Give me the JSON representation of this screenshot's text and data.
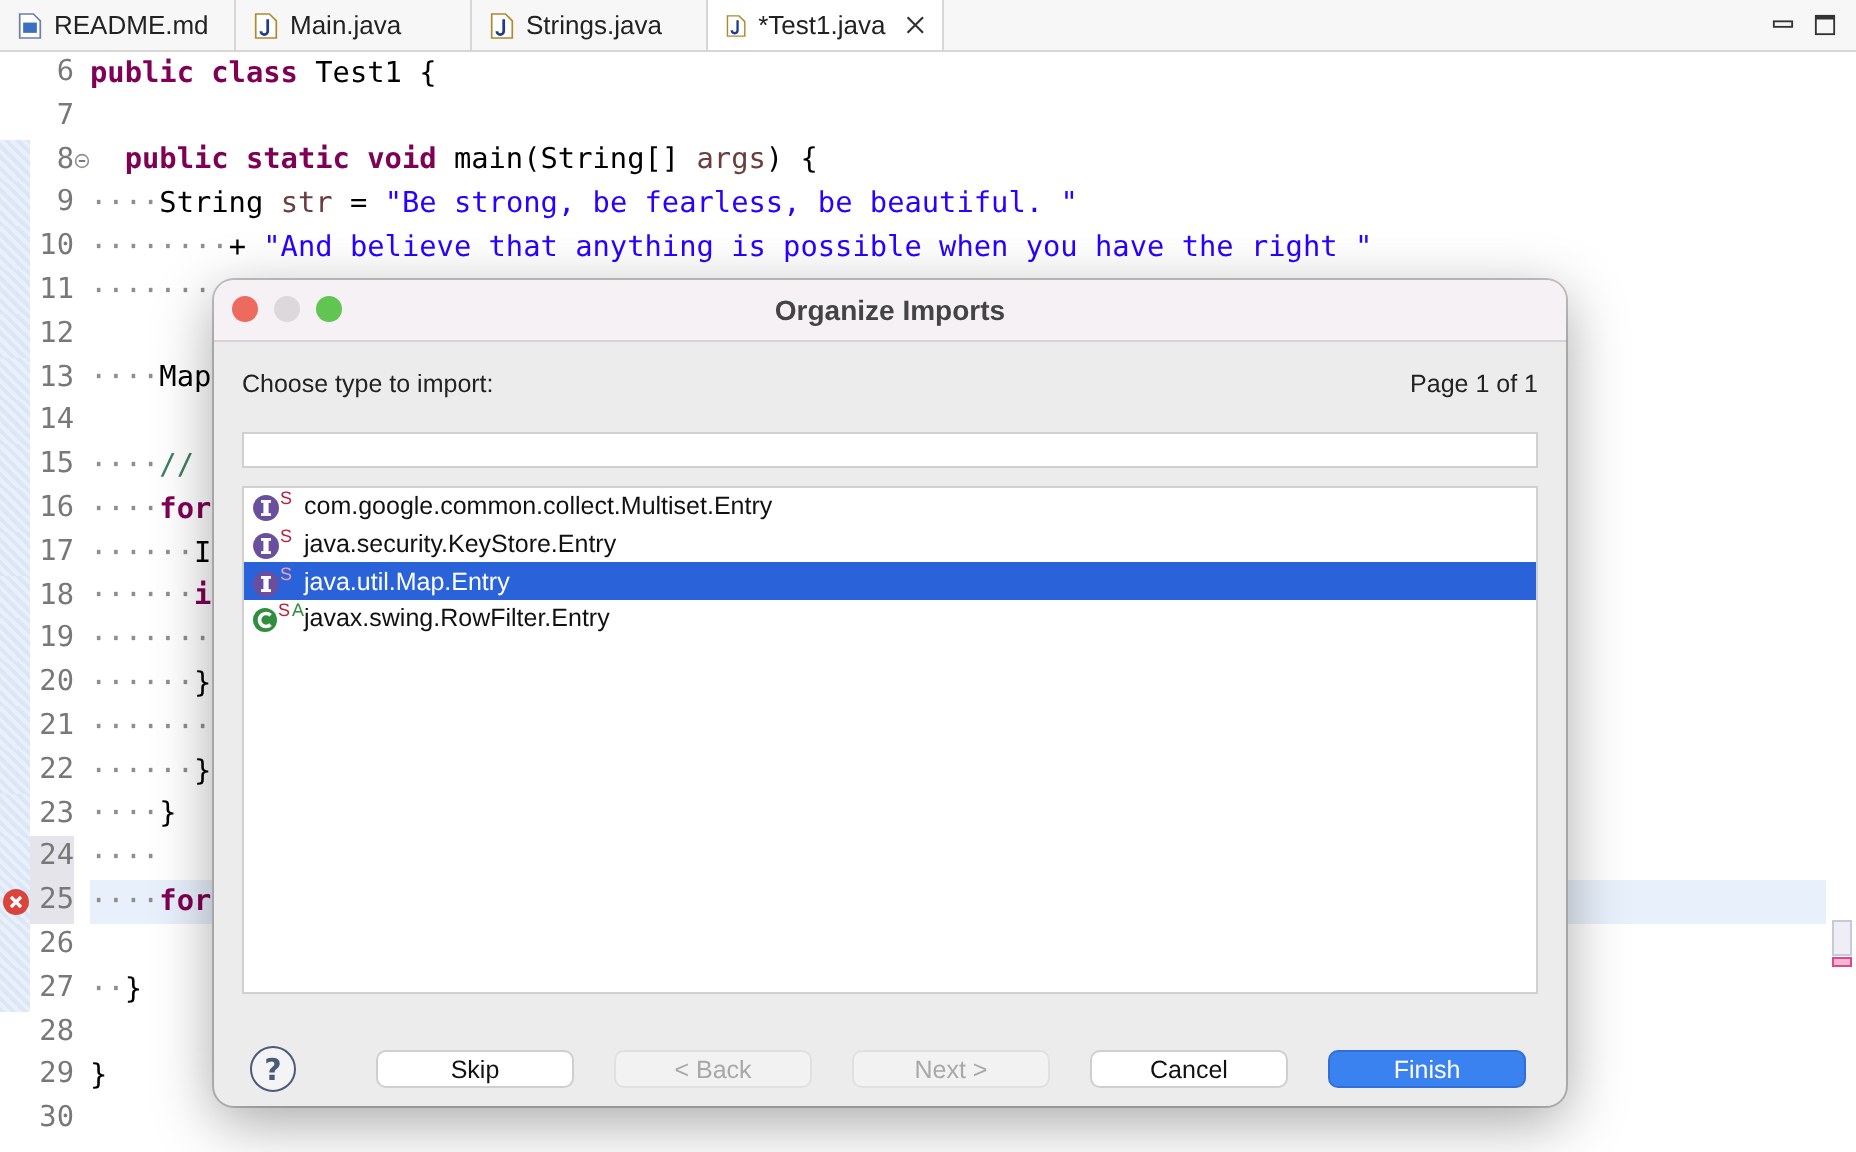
{
  "tabs": [
    {
      "label": "README.md",
      "kind": "markdown",
      "selected": false
    },
    {
      "label": "Main.java",
      "kind": "java",
      "selected": false
    },
    {
      "label": "Strings.java",
      "kind": "java",
      "selected": false
    },
    {
      "label": "*Test1.java",
      "kind": "java",
      "selected": true
    }
  ],
  "editor": {
    "lines": [
      {
        "number": "6",
        "changed": false,
        "current": false,
        "shaded": false,
        "error": false,
        "fold": false,
        "tokens": [
          {
            "kind": "kw",
            "text": "public class"
          },
          {
            "kind": "plain",
            "text": " Test1 {"
          }
        ]
      },
      {
        "number": "7",
        "changed": false,
        "current": false,
        "shaded": false,
        "error": false,
        "fold": false
      },
      {
        "number": "8",
        "changed": true,
        "current": false,
        "shaded": false,
        "error": false,
        "fold": true,
        "tokens": [
          {
            "kind": "kw",
            "text": "  public static void"
          },
          {
            "kind": "plain",
            "text": " main(String[] "
          },
          {
            "kind": "var",
            "text": "args"
          },
          {
            "kind": "plain",
            "text": ") {"
          }
        ]
      },
      {
        "number": "9",
        "changed": true,
        "current": false,
        "shaded": false,
        "error": false,
        "fold": false,
        "tokens": [
          {
            "kind": "ws",
            "text": "····"
          },
          {
            "kind": "plain",
            "text": "String "
          },
          {
            "kind": "var",
            "text": "str"
          },
          {
            "kind": "plain",
            "text": " = "
          },
          {
            "kind": "str",
            "text": "\"Be strong, be fearless, be beautiful. \""
          }
        ]
      },
      {
        "number": "10",
        "changed": true,
        "current": false,
        "shaded": false,
        "error": false,
        "fold": false,
        "tokens": [
          {
            "kind": "ws",
            "text": "········"
          },
          {
            "kind": "plain",
            "text": "+ "
          },
          {
            "kind": "str",
            "text": "\"And believe that anything is possible when you have the right \""
          }
        ]
      },
      {
        "number": "11",
        "changed": true,
        "current": false,
        "shaded": false,
        "error": false,
        "fold": false,
        "tokens": [
          {
            "kind": "ws",
            "text": "·······"
          }
        ]
      },
      {
        "number": "12",
        "changed": true,
        "current": false,
        "shaded": false,
        "error": false,
        "fold": false
      },
      {
        "number": "13",
        "changed": true,
        "current": false,
        "shaded": false,
        "error": false,
        "fold": false,
        "tokens": [
          {
            "kind": "ws",
            "text": "····"
          },
          {
            "kind": "plain",
            "text": "Map"
          }
        ]
      },
      {
        "number": "14",
        "changed": true,
        "current": false,
        "shaded": false,
        "error": false,
        "fold": false
      },
      {
        "number": "15",
        "changed": true,
        "current": false,
        "shaded": false,
        "error": false,
        "fold": false,
        "tokens": [
          {
            "kind": "ws",
            "text": "····"
          },
          {
            "kind": "comment",
            "text": "//"
          }
        ]
      },
      {
        "number": "16",
        "changed": true,
        "current": false,
        "shaded": false,
        "error": false,
        "fold": false,
        "tokens": [
          {
            "kind": "ws",
            "text": "····"
          },
          {
            "kind": "kw",
            "text": "for"
          }
        ]
      },
      {
        "number": "17",
        "changed": true,
        "current": false,
        "shaded": false,
        "error": false,
        "fold": false,
        "tokens": [
          {
            "kind": "ws",
            "text": "······"
          },
          {
            "kind": "plain",
            "text": "I"
          }
        ]
      },
      {
        "number": "18",
        "changed": true,
        "current": false,
        "shaded": false,
        "error": false,
        "fold": false,
        "tokens": [
          {
            "kind": "ws",
            "text": "······"
          },
          {
            "kind": "kw",
            "text": "i"
          }
        ]
      },
      {
        "number": "19",
        "changed": true,
        "current": false,
        "shaded": false,
        "error": false,
        "fold": false,
        "tokens": [
          {
            "kind": "ws",
            "text": "·······"
          }
        ]
      },
      {
        "number": "20",
        "changed": true,
        "current": false,
        "shaded": false,
        "error": false,
        "fold": false,
        "tokens": [
          {
            "kind": "ws",
            "text": "······"
          },
          {
            "kind": "plain",
            "text": "}"
          }
        ]
      },
      {
        "number": "21",
        "changed": true,
        "current": false,
        "shaded": false,
        "error": false,
        "fold": false,
        "tokens": [
          {
            "kind": "ws",
            "text": "·······"
          }
        ]
      },
      {
        "number": "22",
        "changed": true,
        "current": false,
        "shaded": false,
        "error": false,
        "fold": false,
        "tokens": [
          {
            "kind": "ws",
            "text": "······"
          },
          {
            "kind": "plain",
            "text": "}"
          }
        ]
      },
      {
        "number": "23",
        "changed": true,
        "current": false,
        "shaded": false,
        "error": false,
        "fold": false,
        "tokens": [
          {
            "kind": "ws",
            "text": "····"
          },
          {
            "kind": "plain",
            "text": "}"
          }
        ]
      },
      {
        "number": "24",
        "changed": true,
        "current": false,
        "shaded": true,
        "error": false,
        "fold": false,
        "tokens": [
          {
            "kind": "ws",
            "text": "····"
          }
        ]
      },
      {
        "number": "25",
        "changed": true,
        "current": true,
        "shaded": true,
        "error": true,
        "fold": false,
        "tokens": [
          {
            "kind": "ws",
            "text": "····"
          },
          {
            "kind": "kw",
            "text": "for"
          }
        ]
      },
      {
        "number": "26",
        "changed": true,
        "current": false,
        "shaded": false,
        "error": false,
        "fold": false
      },
      {
        "number": "27",
        "changed": true,
        "current": false,
        "shaded": false,
        "error": false,
        "fold": false,
        "tokens": [
          {
            "kind": "ws",
            "text": "··"
          },
          {
            "kind": "plain",
            "text": "}"
          }
        ]
      },
      {
        "number": "28",
        "changed": false,
        "current": false,
        "shaded": false,
        "error": false,
        "fold": false
      },
      {
        "number": "29",
        "changed": false,
        "current": false,
        "shaded": false,
        "error": false,
        "fold": false,
        "tokens": [
          {
            "kind": "plain",
            "text": "}"
          }
        ]
      },
      {
        "number": "30",
        "changed": false,
        "current": false,
        "shaded": false,
        "error": false,
        "fold": false
      }
    ]
  },
  "dialog": {
    "title": "Organize Imports",
    "prompt": "Choose type to import:",
    "page": "Page 1 of 1",
    "items": [
      {
        "name": "com.google.common.collect.Multiset.Entry",
        "kind": "interface",
        "badges": [
          "S"
        ],
        "selected": false
      },
      {
        "name": "java.security.KeyStore.Entry",
        "kind": "interface",
        "badges": [
          "S"
        ],
        "selected": false
      },
      {
        "name": "java.util.Map.Entry",
        "kind": "interface",
        "badges": [
          "S"
        ],
        "selected": true
      },
      {
        "name": "javax.swing.RowFilter.Entry",
        "kind": "class",
        "badges": [
          "S",
          "A"
        ],
        "selected": false
      }
    ],
    "help": "?",
    "buttons": [
      {
        "label": "Skip",
        "disabled": false,
        "default": false
      },
      {
        "label": "< Back",
        "disabled": true,
        "default": false
      },
      {
        "label": "Next >",
        "disabled": true,
        "default": false
      },
      {
        "label": "Cancel",
        "disabled": false,
        "default": false
      },
      {
        "label": "Finish",
        "disabled": false,
        "default": true
      }
    ]
  }
}
